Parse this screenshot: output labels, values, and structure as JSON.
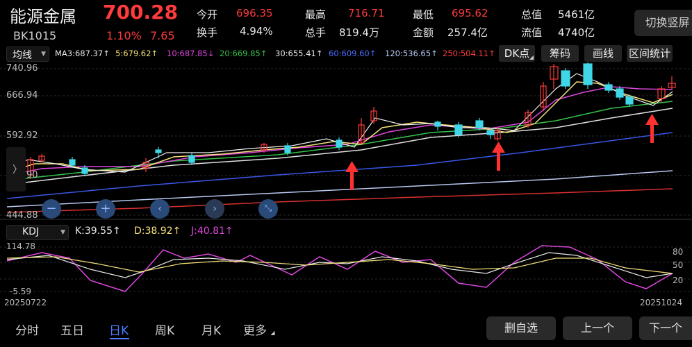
{
  "header": {
    "name": "能源金属",
    "code": "BK1015",
    "price": "700.28",
    "change_pct": "1.10%",
    "change_amt": "7.65",
    "stats": [
      {
        "label": "今开",
        "value": "696.35",
        "color": "red"
      },
      {
        "label": "最高",
        "value": "716.71",
        "color": "red"
      },
      {
        "label": "最低",
        "value": "695.62",
        "color": "red"
      },
      {
        "label": "总值",
        "value": "5461亿",
        "color": "white"
      },
      {
        "label": "换手",
        "value": "4.94%",
        "color": "white"
      },
      {
        "label": "总手",
        "value": "819.4万",
        "color": "white"
      },
      {
        "label": "金额",
        "value": "257.4亿",
        "color": "white"
      },
      {
        "label": "流值",
        "value": "4740亿",
        "color": "white"
      }
    ],
    "switch_label": "切换竖屏"
  },
  "toolbar": {
    "indicator_select": "均线",
    "ma_values": [
      {
        "label": "MA3:687.37↑",
        "color": "#e8e8e8"
      },
      {
        "label": "5:679.62↑",
        "color": "#f5e27a"
      },
      {
        "label": "10:687.85↓",
        "color": "#e046e0"
      },
      {
        "label": "20:669.85↑",
        "color": "#35c24a"
      },
      {
        "label": "30:655.41↑",
        "color": "#e8e8e8"
      },
      {
        "label": "60:609.60↑",
        "color": "#4a6cff"
      },
      {
        "label": "120:536.65↑",
        "color": "#b8c8f0"
      },
      {
        "label": "250:504.11↑",
        "color": "#ff3b3b"
      }
    ],
    "buttons": [
      "DK点",
      "筹码",
      "画线",
      "区间统计"
    ]
  },
  "price_axis": [
    "740.96",
    "666.94",
    "592.92",
    "518.90",
    "444.88"
  ],
  "kdj": {
    "select": "KDJ",
    "values": [
      {
        "label": "K:39.55↑",
        "color": "#e8e8e8"
      },
      {
        "label": "D:38.92↑",
        "color": "#f5e27a"
      },
      {
        "label": "J:40.81↑",
        "color": "#e046e0"
      }
    ],
    "axis_left": [
      "114.78",
      "-5.59"
    ],
    "axis_right": [
      "80",
      "50",
      "20"
    ]
  },
  "dates": {
    "start": "20250722",
    "end": "20251024"
  },
  "bottom_tabs": [
    "分时",
    "五日",
    "日K",
    "周K",
    "月K",
    "更多"
  ],
  "active_tab": "日K",
  "bottom_buttons": [
    "删自选",
    "上一个",
    "下一个"
  ]
}
